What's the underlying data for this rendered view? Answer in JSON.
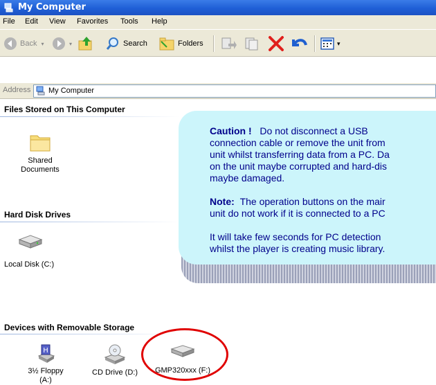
{
  "window": {
    "title": "My Computer"
  },
  "menu": [
    "File",
    "Edit",
    "View",
    "Favorites",
    "Tools",
    "Help"
  ],
  "toolbar": {
    "back": "Back",
    "search": "Search",
    "folders": "Folders"
  },
  "address": {
    "label": "Address",
    "value": "My Computer"
  },
  "sections": {
    "files": "Files Stored on This Computer",
    "hard_disks": "Hard Disk Drives",
    "removable": "Devices with Removable Storage"
  },
  "items": {
    "shared_documents_1": "Shared",
    "shared_documents_2": "Documents",
    "local_disk": "Local Disk (C:)",
    "floppy_1": "3½ Floppy",
    "floppy_2": "(A:)",
    "cd_drive": "CD Drive (D:)",
    "gmp": "GMP320xxx (F:)"
  },
  "callout": {
    "caution_head": "Caution !",
    "caution_l1": "Do not disconnect a USB",
    "caution_l2": "connection cable or remove the unit from",
    "caution_l3": "unit whilst transferring data from a PC. Da",
    "caution_l4": "on the unit maybe corrupted and hard-dis",
    "caution_l5": "maybe damaged.",
    "note_head": "Note:",
    "note_l1": "The operation buttons on the mair",
    "note_l2": "unit do not work if it is connected to a PC",
    "info_l1": "It will take few seconds for PC detection",
    "info_l2": "whilst the player is creating music library."
  },
  "colors": {
    "titlebar": "#1f5fd6",
    "callout_bg": "#ccf5fb",
    "callout_text": "#00008b",
    "highlight_ring": "#e00000"
  }
}
